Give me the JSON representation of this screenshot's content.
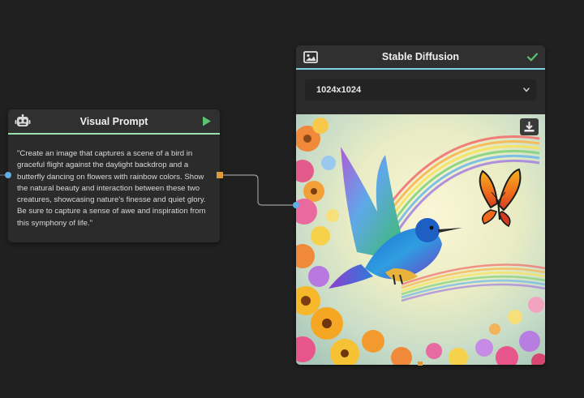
{
  "nodes": {
    "visual_prompt": {
      "title": "Visual Prompt",
      "icon": "robot-icon",
      "run_icon": "play-icon",
      "accent_color": "#9be0ae",
      "prompt": "\"Create an image that captures a scene of a bird in graceful flight against the daylight backdrop and a butterfly dancing on flowers with rainbow colors. Show the natural beauty and interaction between these two creatures, showcasing nature's finesse and quiet glory. Be sure to capture a sense of awe and inspiration from this symphony of life.\""
    },
    "stable_diffusion": {
      "title": "Stable Diffusion",
      "icon": "image-icon",
      "status_icon": "checkmark-icon",
      "accent_color": "#7fd1e6",
      "size": {
        "selected": "1024x1024"
      },
      "download_icon": "download-icon",
      "image_description": "hummingbird-and-butterfly-with-rainbow-and-flowers"
    }
  },
  "colors": {
    "canvas_bg": "#202020",
    "node_bg": "#2b2b2b",
    "input_port": "#5fb0e8",
    "output_port": "#e09a3c",
    "wire": "#9a9a9a",
    "success": "#5cc26f"
  }
}
